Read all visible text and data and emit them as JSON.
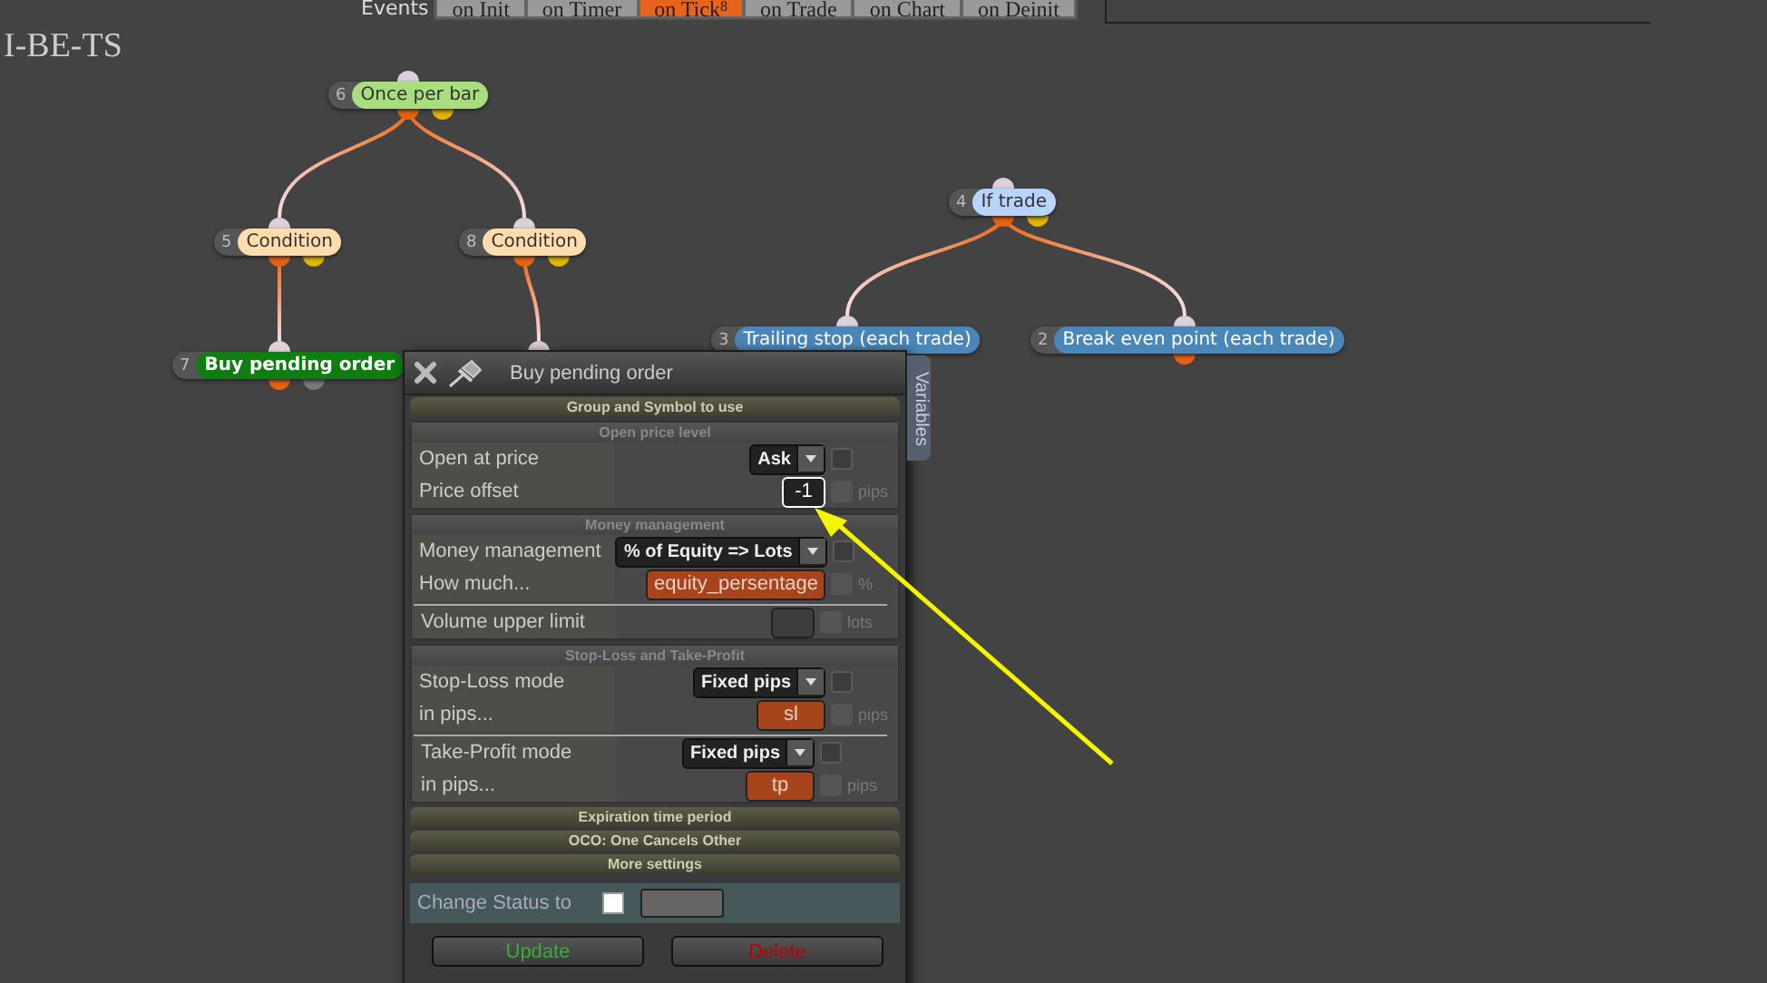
{
  "events": {
    "label": "Events",
    "tabs": [
      {
        "label": "on Init",
        "selected": false
      },
      {
        "label": "on Timer",
        "selected": false
      },
      {
        "label": "on Tick",
        "badge": "8",
        "selected": true
      },
      {
        "label": "on Trade",
        "selected": false
      },
      {
        "label": "on Chart",
        "selected": false
      },
      {
        "label": "on Deinit",
        "selected": false
      }
    ]
  },
  "project_title": "I-BE-TS",
  "diagram": {
    "nodes": [
      {
        "number": "6",
        "label": "Once per bar",
        "color": "#a8de80",
        "kind": "block",
        "pins": [
          {
            "color": "#e8620f"
          },
          {
            "color": "#e0b400"
          }
        ],
        "children": [
          {
            "number": "5",
            "label": "Condition",
            "color": "#fddcae",
            "kind": "block",
            "pins": [
              {
                "color": "#e8620f"
              },
              {
                "color": "#e0b400"
              }
            ],
            "children": [
              {
                "number": "7",
                "label": "Buy pending order",
                "color": "#0f7d12",
                "kind": "action",
                "pins": [
                  {
                    "color": "#e8620f"
                  },
                  {
                    "color": "#7a7a7a"
                  }
                ]
              }
            ]
          },
          {
            "number": "8",
            "label": "Condition",
            "color": "#fddcae",
            "kind": "block",
            "pins": [
              {
                "color": "#e8620f"
              },
              {
                "color": "#e0b400"
              }
            ],
            "children": [
              {
                "kind": "covered"
              }
            ]
          }
        ]
      },
      {
        "number": "4",
        "label": "If trade",
        "color": "#b8d4fb",
        "kind": "block",
        "pins": [
          {
            "color": "#e8620f"
          },
          {
            "color": "#e0b400"
          }
        ],
        "children": [
          {
            "number": "3",
            "label": "Trailing stop (each trade)",
            "color": "#4a86b8",
            "kind": "block"
          },
          {
            "number": "2",
            "label": "Break even point (each trade)",
            "color": "#4a86b8",
            "kind": "block",
            "pins": [
              {
                "color": "#e8620f"
              }
            ]
          }
        ]
      }
    ]
  },
  "dialog": {
    "title": "Buy pending order",
    "side_tab": "Variables",
    "groups": [
      {
        "kind": "header",
        "title": "Group and Symbol to use"
      },
      {
        "kind": "section",
        "title": "Open price level",
        "blocks": [
          [
            {
              "label": "Open at price",
              "kind": "select",
              "value": "Ask",
              "checked": false
            },
            {
              "label": "Price offset",
              "kind": "input",
              "value": "-1",
              "unit": "pips",
              "checked": false
            }
          ]
        ]
      },
      {
        "kind": "section",
        "title": "Money management",
        "blocks": [
          [
            {
              "label": "Money management",
              "kind": "select",
              "value": "% of Equity => Lots",
              "checked": false
            },
            {
              "label": "How much...",
              "kind": "variable",
              "value": "equity_persentage",
              "unit": "%",
              "checked": false
            }
          ],
          [
            {
              "label": "Volume upper limit",
              "kind": "empty",
              "unit": "lots",
              "checked": false
            }
          ]
        ]
      },
      {
        "kind": "section",
        "title": "Stop-Loss and Take-Profit",
        "blocks": [
          [
            {
              "label": "Stop-Loss mode",
              "kind": "select",
              "value": "Fixed pips",
              "checked": false
            },
            {
              "label": "in pips...",
              "kind": "variable",
              "value": "sl",
              "unit": "pips",
              "checked": false
            }
          ],
          [
            {
              "label": "Take-Profit mode",
              "kind": "select",
              "value": "Fixed pips",
              "checked": false
            },
            {
              "label": "in pips...",
              "kind": "variable",
              "value": "tp",
              "unit": "pips",
              "checked": false
            }
          ]
        ]
      },
      {
        "kind": "header",
        "title": "Expiration time period"
      },
      {
        "kind": "header",
        "title": "OCO: One Cancels Other"
      },
      {
        "kind": "header",
        "title": "More settings"
      }
    ],
    "status": {
      "label": "Change Status to",
      "checked": false
    },
    "buttons": [
      {
        "label": "Update",
        "color": "#35b035"
      },
      {
        "label": "Delete",
        "color": "#c00000"
      }
    ]
  }
}
